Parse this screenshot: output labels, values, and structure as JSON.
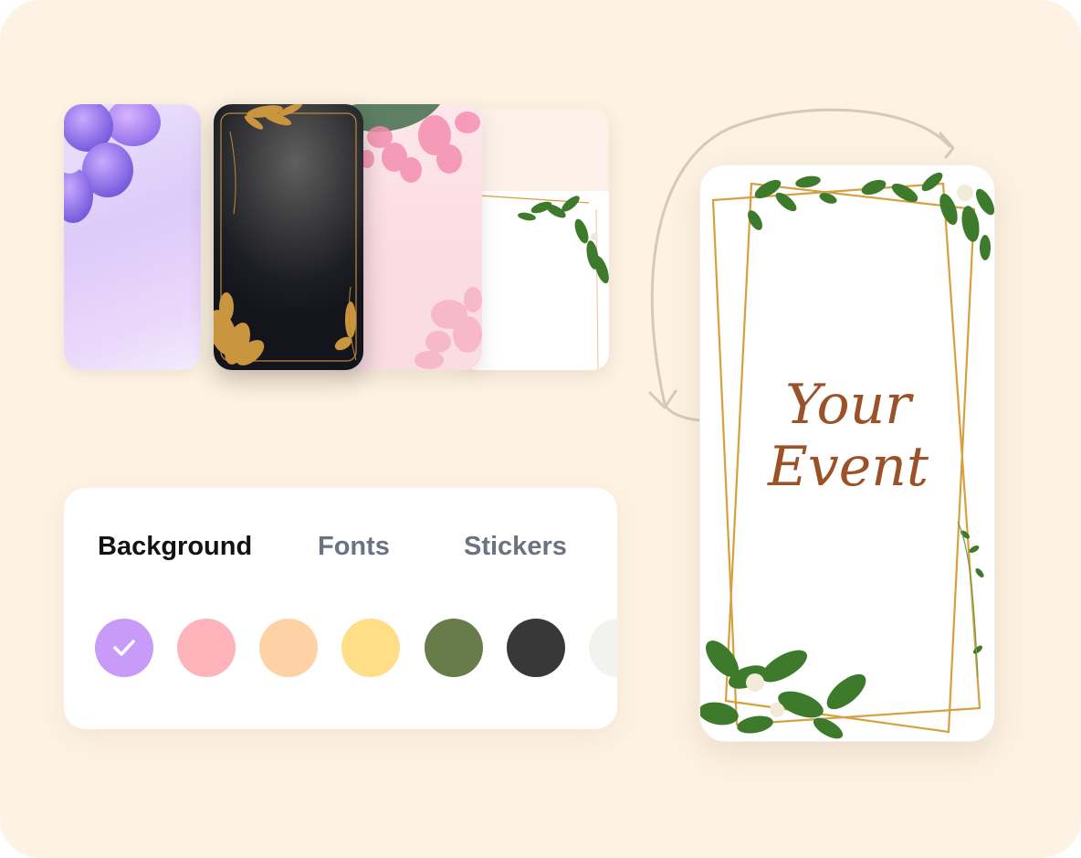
{
  "tabs": {
    "background": "Background",
    "fonts": "Fonts",
    "stickers": "Stickers"
  },
  "swatches": [
    {
      "name": "lavender",
      "color": "#c79bf7",
      "selected": true
    },
    {
      "name": "pink",
      "color": "#ffb3bb",
      "selected": false
    },
    {
      "name": "peach",
      "color": "#ffd2a6",
      "selected": false
    },
    {
      "name": "yellow",
      "color": "#ffde87",
      "selected": false
    },
    {
      "name": "olive-green",
      "color": "#677c4a",
      "selected": false
    },
    {
      "name": "charcoal",
      "color": "#383838",
      "selected": false
    },
    {
      "name": "off-white",
      "color": "#f2f2ef",
      "selected": false
    }
  ],
  "templates": [
    "purple-petals",
    "black-gold-leaves",
    "pink-watercolor",
    "white-greenery"
  ],
  "preview": {
    "title_line1": "Your",
    "title_line2": "Event"
  },
  "colors": {
    "canvas": "#fdf2e3",
    "title": "#9c5228",
    "gold": "#d6a03f",
    "leaf": "#3d7a2c",
    "arrow": "#d8c9b6"
  }
}
